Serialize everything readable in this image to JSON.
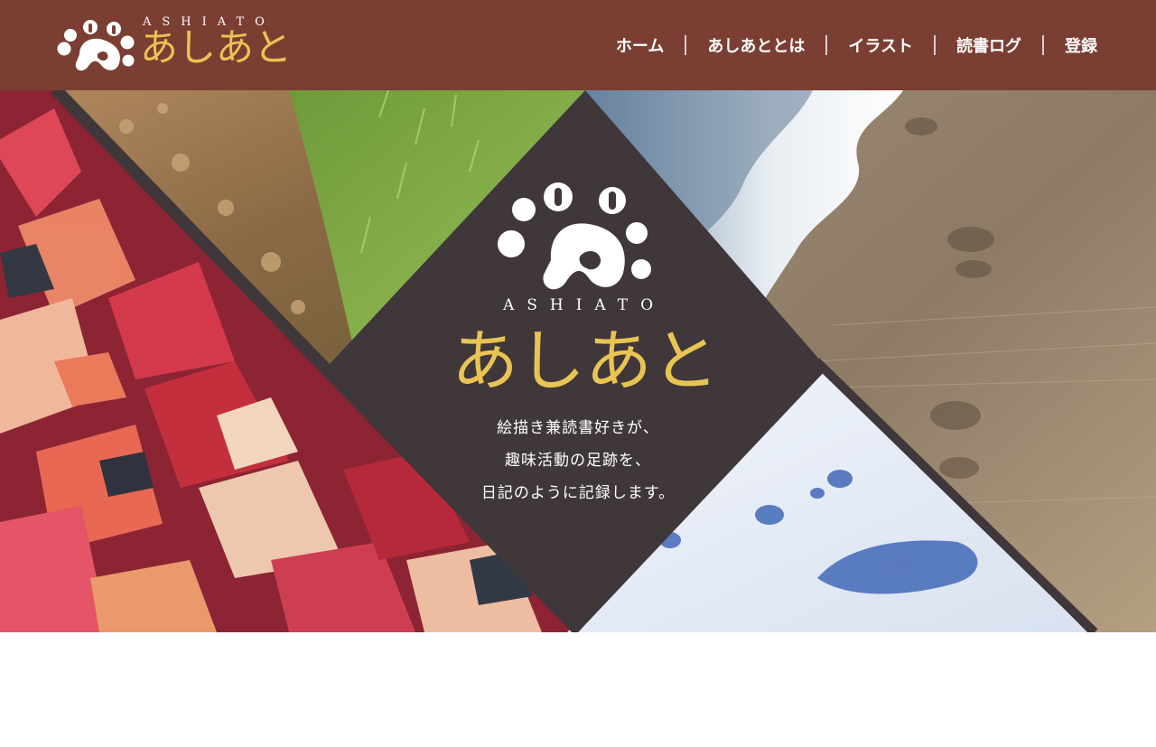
{
  "header": {
    "logo": {
      "latin": "ASHIATO",
      "japanese": "あしあと",
      "icon": "paw-print-icon"
    },
    "nav": [
      {
        "label": "ホーム"
      },
      {
        "label": "あしあととは"
      },
      {
        "label": "イラスト"
      },
      {
        "label": "読書ログ"
      },
      {
        "label": "登録"
      }
    ]
  },
  "hero": {
    "logo": {
      "latin": "ASHIATO",
      "japanese": "あしあと",
      "icon": "paw-print-icon"
    },
    "tagline": [
      "絵描き兼読書好きが、",
      "趣味活動の足跡を、",
      "日記のように記録します。"
    ],
    "photos": [
      "autumn-leaves-photo",
      "dirt-path-grass-photo",
      "beach-footprints-photo",
      "snow-footprints-photo"
    ]
  },
  "colors": {
    "header_bg": "#7b3e33",
    "accent_gold": "#e9c453",
    "diamond_bg": "#3f373a",
    "nav_text": "#ffffff"
  }
}
